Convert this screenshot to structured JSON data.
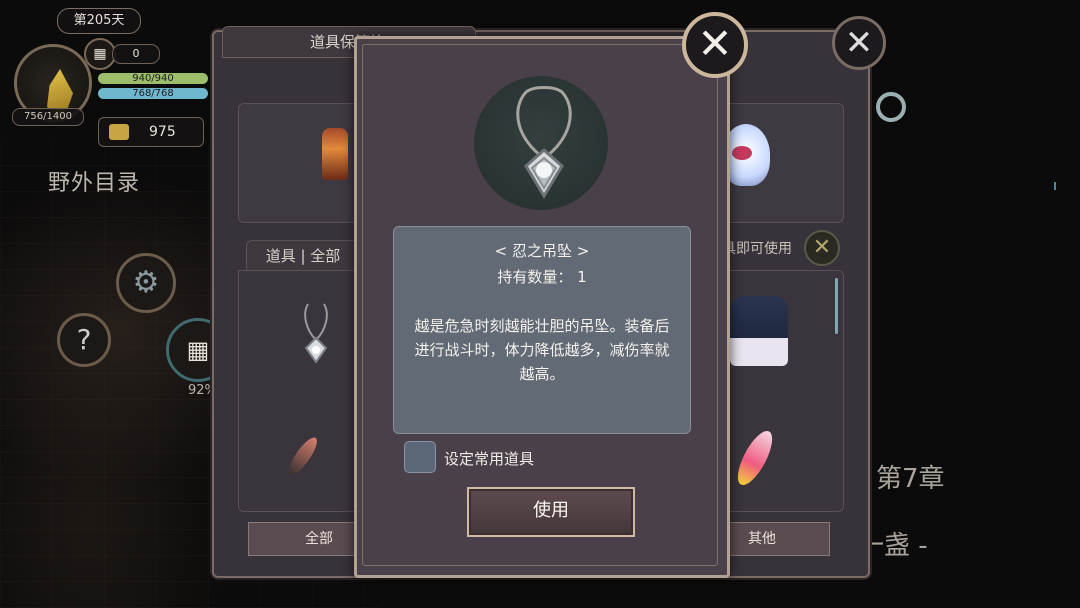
{
  "hud": {
    "day": "第205天",
    "hp_small": "756/1400",
    "calendar_count": "0",
    "bar_green": "940/940",
    "bar_blue": "768/768",
    "gold": "975",
    "field_catalog": "野外目录",
    "progress_percent": "92%"
  },
  "backpanel": {
    "title": "道具保管箱",
    "tab_label": "道具 | 全部",
    "hint": "具即可使用",
    "btn_all": "全部",
    "btn_other": "其他"
  },
  "side": {
    "chapter": "第7章",
    "chapter_sub": "后一盏 -"
  },
  "dialog": {
    "item_name": "< 忍之吊坠 >",
    "quantity": "持有数量： 1",
    "description": "越是危急时刻越能壮胆的吊坠。装备后进行战斗时，体力降低越多，减伤率就越高。",
    "set_favorite_label": "设定常用道具",
    "set_favorite_checked": false,
    "use_button": "使用"
  },
  "colors": {
    "dialog_bg": "#4a4049",
    "desc_box": "#626a76",
    "accent_border": "#b2a293"
  }
}
